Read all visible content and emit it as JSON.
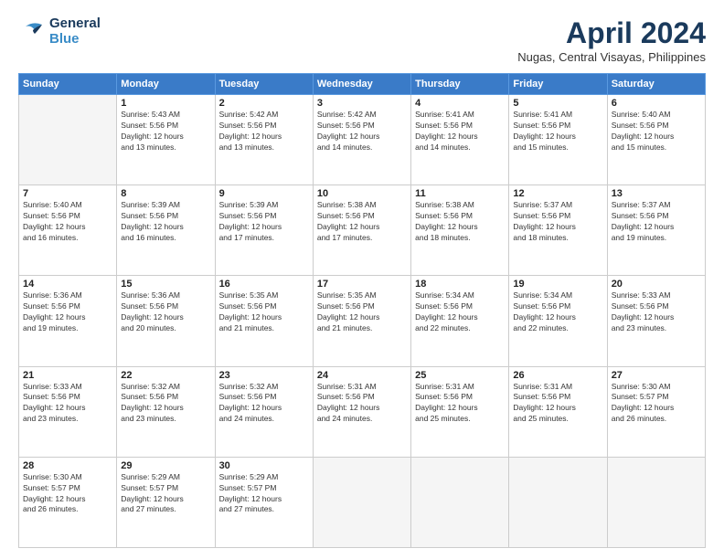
{
  "header": {
    "logo_general": "General",
    "logo_blue": "Blue",
    "month_title": "April 2024",
    "location": "Nugas, Central Visayas, Philippines"
  },
  "weekdays": [
    "Sunday",
    "Monday",
    "Tuesday",
    "Wednesday",
    "Thursday",
    "Friday",
    "Saturday"
  ],
  "days": [
    {
      "date": "",
      "info": ""
    },
    {
      "date": "1",
      "info": "Sunrise: 5:43 AM\nSunset: 5:56 PM\nDaylight: 12 hours\nand 13 minutes."
    },
    {
      "date": "2",
      "info": "Sunrise: 5:42 AM\nSunset: 5:56 PM\nDaylight: 12 hours\nand 13 minutes."
    },
    {
      "date": "3",
      "info": "Sunrise: 5:42 AM\nSunset: 5:56 PM\nDaylight: 12 hours\nand 14 minutes."
    },
    {
      "date": "4",
      "info": "Sunrise: 5:41 AM\nSunset: 5:56 PM\nDaylight: 12 hours\nand 14 minutes."
    },
    {
      "date": "5",
      "info": "Sunrise: 5:41 AM\nSunset: 5:56 PM\nDaylight: 12 hours\nand 15 minutes."
    },
    {
      "date": "6",
      "info": "Sunrise: 5:40 AM\nSunset: 5:56 PM\nDaylight: 12 hours\nand 15 minutes."
    },
    {
      "date": "7",
      "info": "Sunrise: 5:40 AM\nSunset: 5:56 PM\nDaylight: 12 hours\nand 16 minutes."
    },
    {
      "date": "8",
      "info": "Sunrise: 5:39 AM\nSunset: 5:56 PM\nDaylight: 12 hours\nand 16 minutes."
    },
    {
      "date": "9",
      "info": "Sunrise: 5:39 AM\nSunset: 5:56 PM\nDaylight: 12 hours\nand 17 minutes."
    },
    {
      "date": "10",
      "info": "Sunrise: 5:38 AM\nSunset: 5:56 PM\nDaylight: 12 hours\nand 17 minutes."
    },
    {
      "date": "11",
      "info": "Sunrise: 5:38 AM\nSunset: 5:56 PM\nDaylight: 12 hours\nand 18 minutes."
    },
    {
      "date": "12",
      "info": "Sunrise: 5:37 AM\nSunset: 5:56 PM\nDaylight: 12 hours\nand 18 minutes."
    },
    {
      "date": "13",
      "info": "Sunrise: 5:37 AM\nSunset: 5:56 PM\nDaylight: 12 hours\nand 19 minutes."
    },
    {
      "date": "14",
      "info": "Sunrise: 5:36 AM\nSunset: 5:56 PM\nDaylight: 12 hours\nand 19 minutes."
    },
    {
      "date": "15",
      "info": "Sunrise: 5:36 AM\nSunset: 5:56 PM\nDaylight: 12 hours\nand 20 minutes."
    },
    {
      "date": "16",
      "info": "Sunrise: 5:35 AM\nSunset: 5:56 PM\nDaylight: 12 hours\nand 21 minutes."
    },
    {
      "date": "17",
      "info": "Sunrise: 5:35 AM\nSunset: 5:56 PM\nDaylight: 12 hours\nand 21 minutes."
    },
    {
      "date": "18",
      "info": "Sunrise: 5:34 AM\nSunset: 5:56 PM\nDaylight: 12 hours\nand 22 minutes."
    },
    {
      "date": "19",
      "info": "Sunrise: 5:34 AM\nSunset: 5:56 PM\nDaylight: 12 hours\nand 22 minutes."
    },
    {
      "date": "20",
      "info": "Sunrise: 5:33 AM\nSunset: 5:56 PM\nDaylight: 12 hours\nand 23 minutes."
    },
    {
      "date": "21",
      "info": "Sunrise: 5:33 AM\nSunset: 5:56 PM\nDaylight: 12 hours\nand 23 minutes."
    },
    {
      "date": "22",
      "info": "Sunrise: 5:32 AM\nSunset: 5:56 PM\nDaylight: 12 hours\nand 23 minutes."
    },
    {
      "date": "23",
      "info": "Sunrise: 5:32 AM\nSunset: 5:56 PM\nDaylight: 12 hours\nand 24 minutes."
    },
    {
      "date": "24",
      "info": "Sunrise: 5:31 AM\nSunset: 5:56 PM\nDaylight: 12 hours\nand 24 minutes."
    },
    {
      "date": "25",
      "info": "Sunrise: 5:31 AM\nSunset: 5:56 PM\nDaylight: 12 hours\nand 25 minutes."
    },
    {
      "date": "26",
      "info": "Sunrise: 5:31 AM\nSunset: 5:56 PM\nDaylight: 12 hours\nand 25 minutes."
    },
    {
      "date": "27",
      "info": "Sunrise: 5:30 AM\nSunset: 5:57 PM\nDaylight: 12 hours\nand 26 minutes."
    },
    {
      "date": "28",
      "info": "Sunrise: 5:30 AM\nSunset: 5:57 PM\nDaylight: 12 hours\nand 26 minutes."
    },
    {
      "date": "29",
      "info": "Sunrise: 5:29 AM\nSunset: 5:57 PM\nDaylight: 12 hours\nand 27 minutes."
    },
    {
      "date": "30",
      "info": "Sunrise: 5:29 AM\nSunset: 5:57 PM\nDaylight: 12 hours\nand 27 minutes."
    },
    {
      "date": "",
      "info": ""
    },
    {
      "date": "",
      "info": ""
    },
    {
      "date": "",
      "info": ""
    },
    {
      "date": "",
      "info": ""
    }
  ]
}
